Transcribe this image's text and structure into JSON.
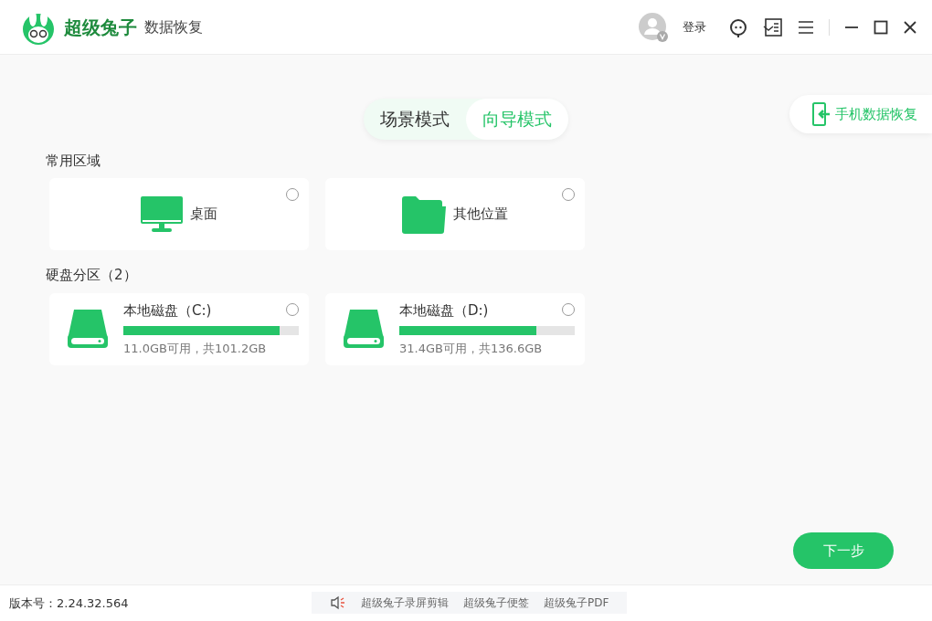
{
  "app": {
    "brand": "超级兔子",
    "product": "数据恢复"
  },
  "header": {
    "login": "登录"
  },
  "mode_tabs": [
    {
      "label": "场景模式",
      "selected": false
    },
    {
      "label": "向导模式",
      "selected": true
    }
  ],
  "phone_recovery": "手机数据恢复",
  "sections": [
    {
      "title": "常用区域",
      "kind": "location",
      "items": [
        {
          "label": "桌面",
          "kind": "desktop",
          "selected": false
        },
        {
          "label": "其他位置",
          "kind": "folder",
          "selected": false
        }
      ]
    },
    {
      "title": "硬盘分区（2）",
      "kind": "disk",
      "items": [
        {
          "label": "本地磁盘（C:)",
          "level": 0.89,
          "usage": "11.0GB可用，共101.2GB",
          "selected": false
        },
        {
          "label": "本地磁盘（D:)",
          "level": 0.78,
          "usage": "31.4GB可用，共136.6GB",
          "selected": false
        }
      ]
    }
  ],
  "next_button": "下一步",
  "footer": {
    "version": "版本号：2.24.32.564",
    "links": [
      "超级兔子录屏剪辑",
      "超级兔子便签",
      "超级兔子PDF"
    ]
  }
}
